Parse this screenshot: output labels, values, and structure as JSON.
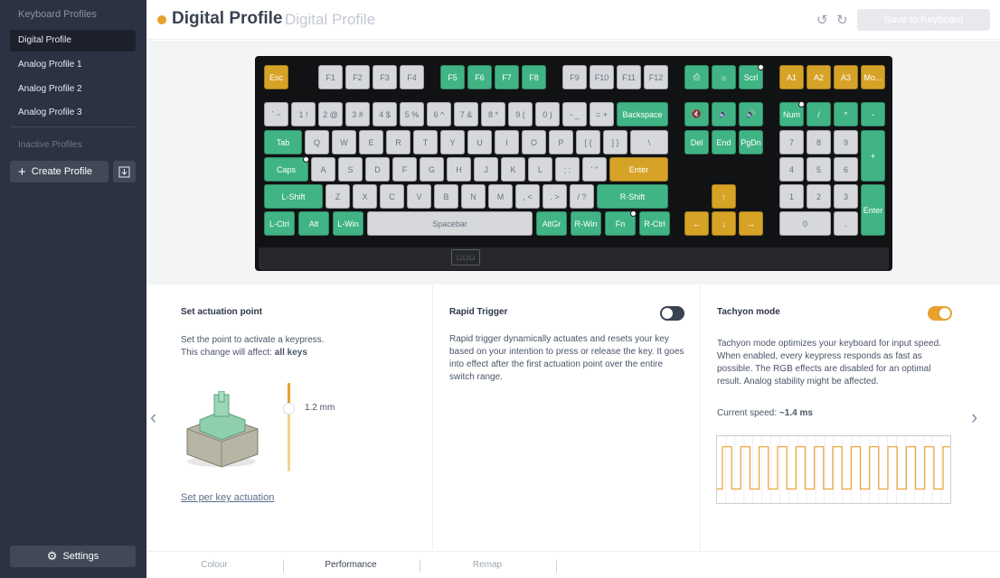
{
  "sidebar": {
    "title": "Keyboard Profiles",
    "profiles": [
      "Digital Profile",
      "Analog Profile 1",
      "Analog Profile 2",
      "Analog Profile 3"
    ],
    "inactive_title": "Inactive Profiles",
    "create_label": "Create Profile",
    "settings_label": "Settings"
  },
  "header": {
    "title": "Digital Profile",
    "subtitle": "Digital Profile",
    "save_label": "Save to Keyboard"
  },
  "keyboard": {
    "logo": "⊔⊔⊔",
    "keys": [
      {
        "label": "Esc",
        "c": "y"
      },
      {
        "label": "F1",
        "c": "g"
      },
      {
        "label": "F2",
        "c": "g"
      },
      {
        "label": "F3",
        "c": "g"
      },
      {
        "label": "F4",
        "c": "g"
      },
      {
        "label": "F5",
        "c": "t"
      },
      {
        "label": "F6",
        "c": "t"
      },
      {
        "label": "F7",
        "c": "t"
      },
      {
        "label": "F8",
        "c": "t"
      },
      {
        "label": "F9",
        "c": "g"
      },
      {
        "label": "F10",
        "c": "g"
      },
      {
        "label": "F11",
        "c": "g"
      },
      {
        "label": "F12",
        "c": "g"
      },
      {
        "label": "⎙",
        "c": "t"
      },
      {
        "label": "☼",
        "c": "t"
      },
      {
        "label": "Scrl",
        "c": "t",
        "ind": true
      },
      {
        "label": "A1",
        "c": "y"
      },
      {
        "label": "A2",
        "c": "y"
      },
      {
        "label": "A3",
        "c": "y"
      },
      {
        "label": "Mo...",
        "c": "y"
      },
      {
        "label": "` ~",
        "c": "g"
      },
      {
        "label": "1 !",
        "c": "g"
      },
      {
        "label": "2 @",
        "c": "g"
      },
      {
        "label": "3 #",
        "c": "g"
      },
      {
        "label": "4 $",
        "c": "g"
      },
      {
        "label": "5 %",
        "c": "g"
      },
      {
        "label": "6 ^",
        "c": "g"
      },
      {
        "label": "7 &",
        "c": "g"
      },
      {
        "label": "8 *",
        "c": "g"
      },
      {
        "label": "9 (",
        "c": "g"
      },
      {
        "label": "0 )",
        "c": "g"
      },
      {
        "label": "- _",
        "c": "g"
      },
      {
        "label": "= +",
        "c": "g"
      },
      {
        "label": "Backspace",
        "c": "t"
      },
      {
        "label": "🔇",
        "c": "t"
      },
      {
        "label": "🔉",
        "c": "t"
      },
      {
        "label": "🔊",
        "c": "t"
      },
      {
        "label": "Num",
        "c": "t",
        "ind": true
      },
      {
        "label": "/",
        "c": "t"
      },
      {
        "label": "*",
        "c": "t"
      },
      {
        "label": "-",
        "c": "t"
      },
      {
        "label": "Tab",
        "c": "t"
      },
      {
        "label": "Q",
        "c": "g"
      },
      {
        "label": "W",
        "c": "g"
      },
      {
        "label": "E",
        "c": "g"
      },
      {
        "label": "R",
        "c": "g"
      },
      {
        "label": "T",
        "c": "g"
      },
      {
        "label": "Y",
        "c": "g"
      },
      {
        "label": "U",
        "c": "g"
      },
      {
        "label": "I",
        "c": "g"
      },
      {
        "label": "O",
        "c": "g"
      },
      {
        "label": "P",
        "c": "g"
      },
      {
        "label": "[ {",
        "c": "g"
      },
      {
        "label": "] }",
        "c": "g"
      },
      {
        "label": "\\",
        "c": "g"
      },
      {
        "label": "Del",
        "c": "t"
      },
      {
        "label": "End",
        "c": "t"
      },
      {
        "label": "PgDn",
        "c": "t"
      },
      {
        "label": "7",
        "c": "g"
      },
      {
        "label": "8",
        "c": "g"
      },
      {
        "label": "9",
        "c": "g"
      },
      {
        "label": "+",
        "c": "t"
      },
      {
        "label": "Caps",
        "c": "t",
        "ind": true
      },
      {
        "label": "A",
        "c": "g"
      },
      {
        "label": "S",
        "c": "g"
      },
      {
        "label": "D",
        "c": "g"
      },
      {
        "label": "F",
        "c": "g"
      },
      {
        "label": "G",
        "c": "g"
      },
      {
        "label": "H",
        "c": "g"
      },
      {
        "label": "J",
        "c": "g"
      },
      {
        "label": "K",
        "c": "g"
      },
      {
        "label": "L",
        "c": "g"
      },
      {
        "label": "; :",
        "c": "g"
      },
      {
        "label": "' \"",
        "c": "g"
      },
      {
        "label": "Enter",
        "c": "y"
      },
      {
        "label": "4",
        "c": "g"
      },
      {
        "label": "5",
        "c": "g"
      },
      {
        "label": "6",
        "c": "g"
      },
      {
        "label": "L-Shift",
        "c": "t"
      },
      {
        "label": "Z",
        "c": "g"
      },
      {
        "label": "X",
        "c": "g"
      },
      {
        "label": "C",
        "c": "g"
      },
      {
        "label": "V",
        "c": "g"
      },
      {
        "label": "B",
        "c": "g"
      },
      {
        "label": "N",
        "c": "g"
      },
      {
        "label": "M",
        "c": "g"
      },
      {
        "label": ", <",
        "c": "g"
      },
      {
        "label": ". >",
        "c": "g"
      },
      {
        "label": "/ ?",
        "c": "g"
      },
      {
        "label": "R-Shift",
        "c": "t"
      },
      {
        "label": "↑",
        "c": "y"
      },
      {
        "label": "1",
        "c": "g"
      },
      {
        "label": "2",
        "c": "g"
      },
      {
        "label": "3",
        "c": "g"
      },
      {
        "label": "Enter",
        "c": "t"
      },
      {
        "label": "L-Ctrl",
        "c": "t"
      },
      {
        "label": "Alt",
        "c": "t"
      },
      {
        "label": "L-Win",
        "c": "t"
      },
      {
        "label": "Spacebar",
        "c": "g"
      },
      {
        "label": "AltGr",
        "c": "t"
      },
      {
        "label": "R-Win",
        "c": "t"
      },
      {
        "label": "Fn",
        "c": "t",
        "ind": true
      },
      {
        "label": "R-Ctrl",
        "c": "t"
      },
      {
        "label": "←",
        "c": "y"
      },
      {
        "label": "↓",
        "c": "y"
      },
      {
        "label": "→",
        "c": "y"
      },
      {
        "label": "0",
        "c": "g"
      },
      {
        "label": ".",
        "c": "g"
      }
    ]
  },
  "actuation": {
    "title": "Set actuation point",
    "desc1": "Set the point to activate a keypress.",
    "desc2_prefix": "This change will affect: ",
    "desc2_bold": "all keys",
    "value": "1.2 mm",
    "link": "Set per key actuation"
  },
  "rapid_trigger": {
    "title": "Rapid Trigger",
    "enabled": false,
    "desc": "Rapid trigger dynamically actuates and resets your key based on your intention to press or release the key. It goes into effect after the first actuation point over the entire switch range."
  },
  "tachyon": {
    "title": "Tachyon mode",
    "enabled": true,
    "desc": "Tachyon mode optimizes your keyboard for input speed. When enabled, every keypress responds as fast as possible. The RGB effects are disabled for an optimal result. Analog stability might be affected.",
    "speed_label": "Current speed: ",
    "speed_value": "~1.4 ms"
  },
  "tabs": {
    "items": [
      "Colour",
      "Performance",
      "Remap"
    ],
    "active": "Performance"
  },
  "colors": {
    "accent": "#e9a02f",
    "teal": "#40b484",
    "gold": "#d6a327",
    "sidebar": "#2b3241"
  }
}
